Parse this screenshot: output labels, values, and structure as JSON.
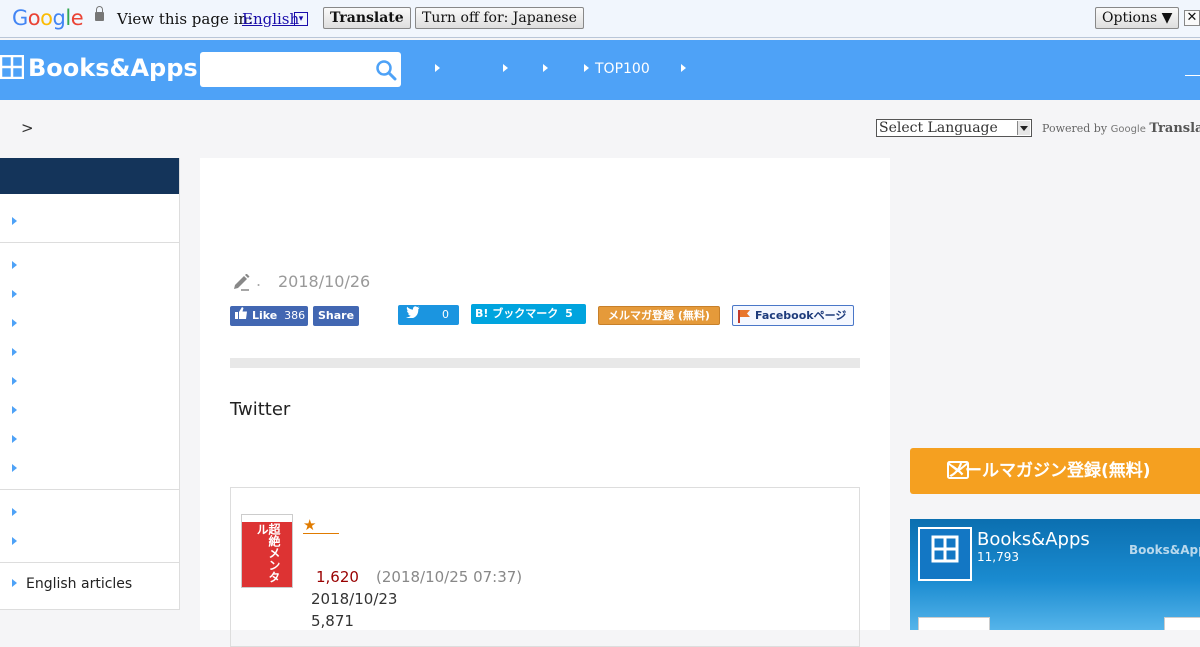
{
  "translate_bar": {
    "logo": "Google",
    "view_text": "View this page in:",
    "language": "English",
    "language_arrow": "▾",
    "translate_button": "Translate",
    "turn_off_button": "Turn off for: Japanese",
    "options_button": "Options ▼",
    "close_button": "✕"
  },
  "header": {
    "logo_text": "Books&Apps",
    "search_placeholder": "",
    "nav": [
      "",
      "",
      "",
      "TOP100",
      ""
    ]
  },
  "breadcrumb": {
    "separator": ">"
  },
  "language_widget": {
    "select_label": "Select Language",
    "powered_by": "Powered by",
    "google": "Google",
    "translate": "Translate"
  },
  "sidebar": {
    "items_group1": [
      ""
    ],
    "items_group2": [
      "",
      "",
      "",
      "",
      "",
      "",
      "",
      ""
    ],
    "items_group3": [
      "",
      ""
    ],
    "english_articles": "English articles"
  },
  "article": {
    "author": ".",
    "date": "2018/10/26",
    "share": {
      "like_label": "Like",
      "like_count": "386",
      "share_label": "Share",
      "tweet_count": "0",
      "hatena_label": "B! ブックマーク",
      "hatena_count": "5",
      "mailmag_label": "メルマガ登録 (無料)",
      "facebook_page_label": "Facebookページ"
    },
    "section_heading": "Twitter",
    "book_card": {
      "star": "★",
      "price": "1,620",
      "price_timestamp": "(2018/10/25 07:37)",
      "release_date": "2018/10/23",
      "rank": "5,871",
      "cover_text": "超絶メンタル"
    }
  },
  "right_column": {
    "mail_button": "メールマガジン登録(無料)",
    "fb_name": "Books&Apps",
    "fb_count": "11,793",
    "fb_watermark": "Books&Apps"
  },
  "colors": {
    "header_blue": "#4ea2f7",
    "sidebar_head": "#14345a",
    "mail_orange": "#f5a020",
    "facebook_blue": "#4267b2"
  }
}
